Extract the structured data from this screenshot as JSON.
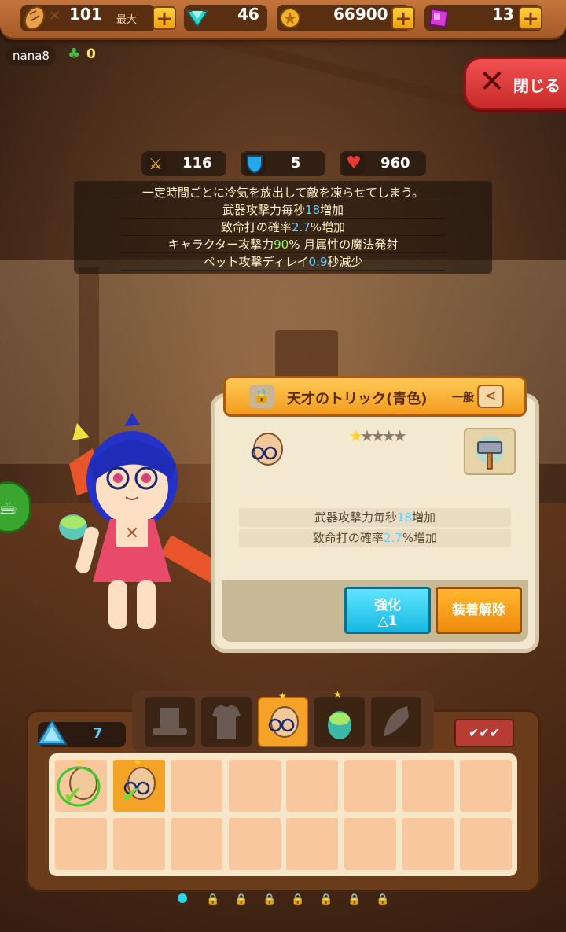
{
  "resources": {
    "bread": {
      "value": "101",
      "max_label": "最大"
    },
    "gem": {
      "value": "46"
    },
    "gold": {
      "value": "66900"
    },
    "crystal": {
      "value": "13"
    }
  },
  "player": {
    "name": "nana8",
    "clover_count": "0"
  },
  "close_button": {
    "label": "閉じる"
  },
  "stats": {
    "attack": "116",
    "defense": "5",
    "hp": "960"
  },
  "description": [
    {
      "parts": [
        {
          "t": "一定時間ごとに冷気を放出して敵を凍らせてしまう。",
          "c": ""
        }
      ]
    },
    {
      "parts": [
        {
          "t": "武器攻撃力毎秒",
          "c": ""
        },
        {
          "t": "18",
          "c": "hl"
        },
        {
          "t": "増加",
          "c": ""
        }
      ]
    },
    {
      "parts": [
        {
          "t": "致命打の確率",
          "c": ""
        },
        {
          "t": "2.7",
          "c": "hl"
        },
        {
          "t": "%増加",
          "c": ""
        }
      ]
    },
    {
      "parts": [
        {
          "t": "キャラクター攻撃力",
          "c": ""
        },
        {
          "t": "90",
          "c": "hl-g"
        },
        {
          "t": "% 月属性の魔法発射",
          "c": ""
        }
      ]
    },
    {
      "parts": [
        {
          "t": "ペット攻撃ディレイ",
          "c": ""
        },
        {
          "t": "0.9",
          "c": "hl"
        },
        {
          "t": "秒減少",
          "c": ""
        }
      ]
    }
  ],
  "item_panel": {
    "title": "天才のトリック(青色)",
    "grade": "一般",
    "stars_filled": 1,
    "stars_total": 5,
    "effects": [
      {
        "parts": [
          {
            "t": "武器攻撃力毎秒",
            "c": ""
          },
          {
            "t": "18",
            "c": "hl"
          },
          {
            "t": "増加",
            "c": ""
          }
        ]
      },
      {
        "parts": [
          {
            "t": "致命打の確率",
            "c": ""
          },
          {
            "t": "2.7",
            "c": "hl"
          },
          {
            "t": "%増加",
            "c": ""
          }
        ]
      }
    ],
    "enhance_button": {
      "label": "強化",
      "cost": "1"
    },
    "unequip_button": {
      "label": "装着解除"
    }
  },
  "inventory": {
    "crystal_count": "7",
    "tabs": [
      "hat",
      "clothes",
      "glasses",
      "egg",
      "wing"
    ],
    "active_tab": 2,
    "page_count": 8,
    "current_page": 0
  },
  "colors": {
    "accent_blue": "#5fd0ff",
    "accent_green": "#8cff4a",
    "active_tab": "#f5a326",
    "close_red": "#e84040"
  }
}
